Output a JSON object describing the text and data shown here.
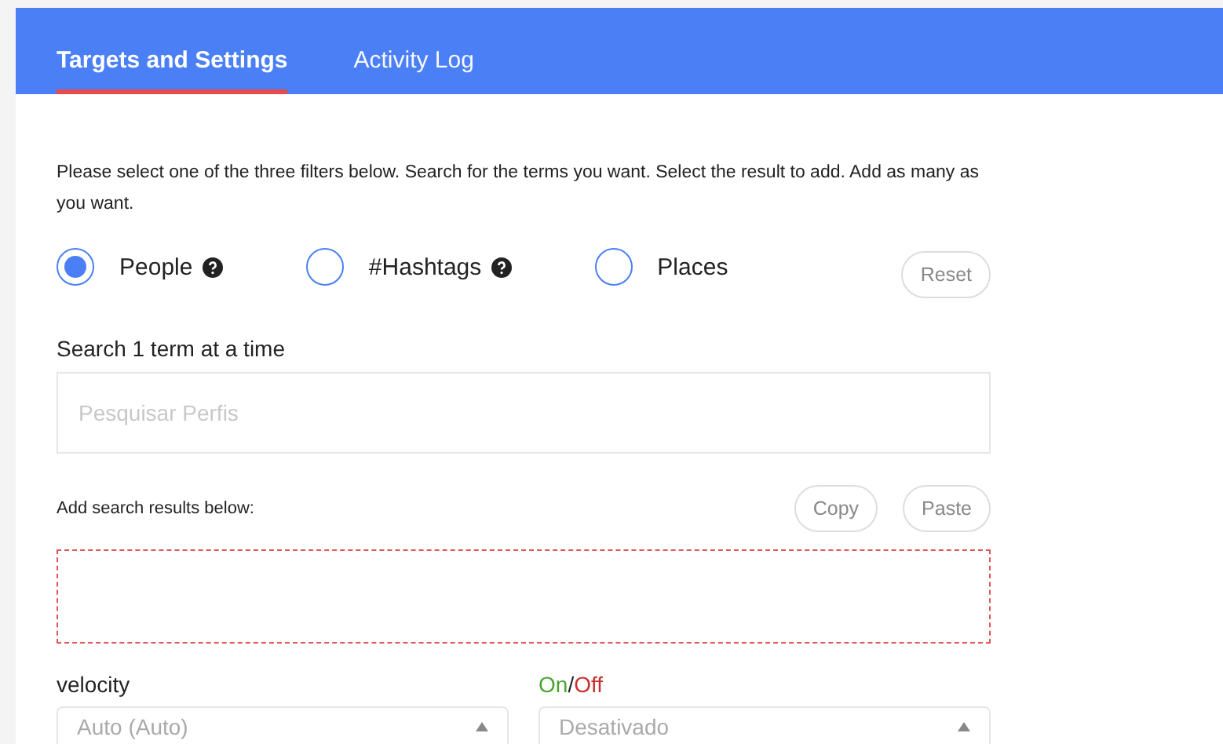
{
  "tabs": [
    {
      "label": "Targets and Settings",
      "selected": true
    },
    {
      "label": "Activity Log",
      "selected": false
    }
  ],
  "instructions": "Please select one of the three filters below. Search for the terms you want. Select the result to add. Add as many as you want.",
  "filters": [
    {
      "label": "People",
      "selected": true,
      "help": true
    },
    {
      "label": "#Hashtags",
      "selected": false,
      "help": true
    },
    {
      "label": "Places",
      "selected": false,
      "help": false
    }
  ],
  "reset_button": "Reset",
  "search": {
    "label": "Search 1 term at a time",
    "placeholder": "Pesquisar Perfis"
  },
  "results": {
    "label": "Add search results below:",
    "buttons": [
      "Copy",
      "Paste"
    ]
  },
  "velocity": {
    "label": "velocity",
    "value": "Auto (Auto)"
  },
  "on_off": {
    "on_label": "On",
    "separator": "/",
    "off_label": "Off",
    "value": "Desativado"
  }
}
